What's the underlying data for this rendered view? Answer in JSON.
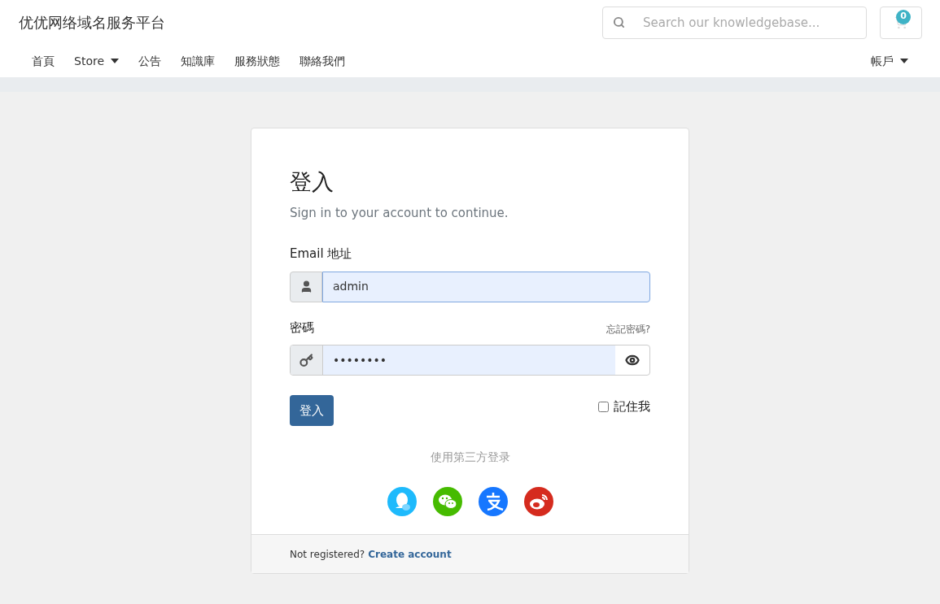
{
  "header": {
    "site_title": "优优网络域名服务平台",
    "search": {
      "placeholder": "Search our knowledgebase..."
    },
    "cart": {
      "count": "0"
    }
  },
  "nav": {
    "items": [
      {
        "label": "首頁",
        "dropdown": false
      },
      {
        "label": "Store",
        "dropdown": true
      },
      {
        "label": "公告",
        "dropdown": false
      },
      {
        "label": "知識庫",
        "dropdown": false
      },
      {
        "label": "服務狀態",
        "dropdown": false
      },
      {
        "label": "聯絡我們",
        "dropdown": false
      }
    ],
    "account": {
      "label": "帳戶",
      "dropdown": true
    }
  },
  "login": {
    "title": "登入",
    "subtitle": "Sign in to your account to continue.",
    "email": {
      "label": "Email 地址",
      "value": "admin"
    },
    "password": {
      "label": "密碼",
      "forgot_link": "忘記密碼?",
      "value": "••••••••"
    },
    "submit": "登入",
    "remember": {
      "label": "記住我",
      "checked": false
    },
    "third_party": {
      "heading": "使用第三方登录",
      "providers": [
        {
          "kind": "qq",
          "color": "#1ebafc"
        },
        {
          "kind": "wechat",
          "color": "#46bb00"
        },
        {
          "kind": "alipay",
          "color": "#1677ff"
        },
        {
          "kind": "weibo",
          "color": "#d52b1e"
        }
      ]
    },
    "footer": {
      "text": "Not registered?",
      "link": "Create account"
    }
  }
}
